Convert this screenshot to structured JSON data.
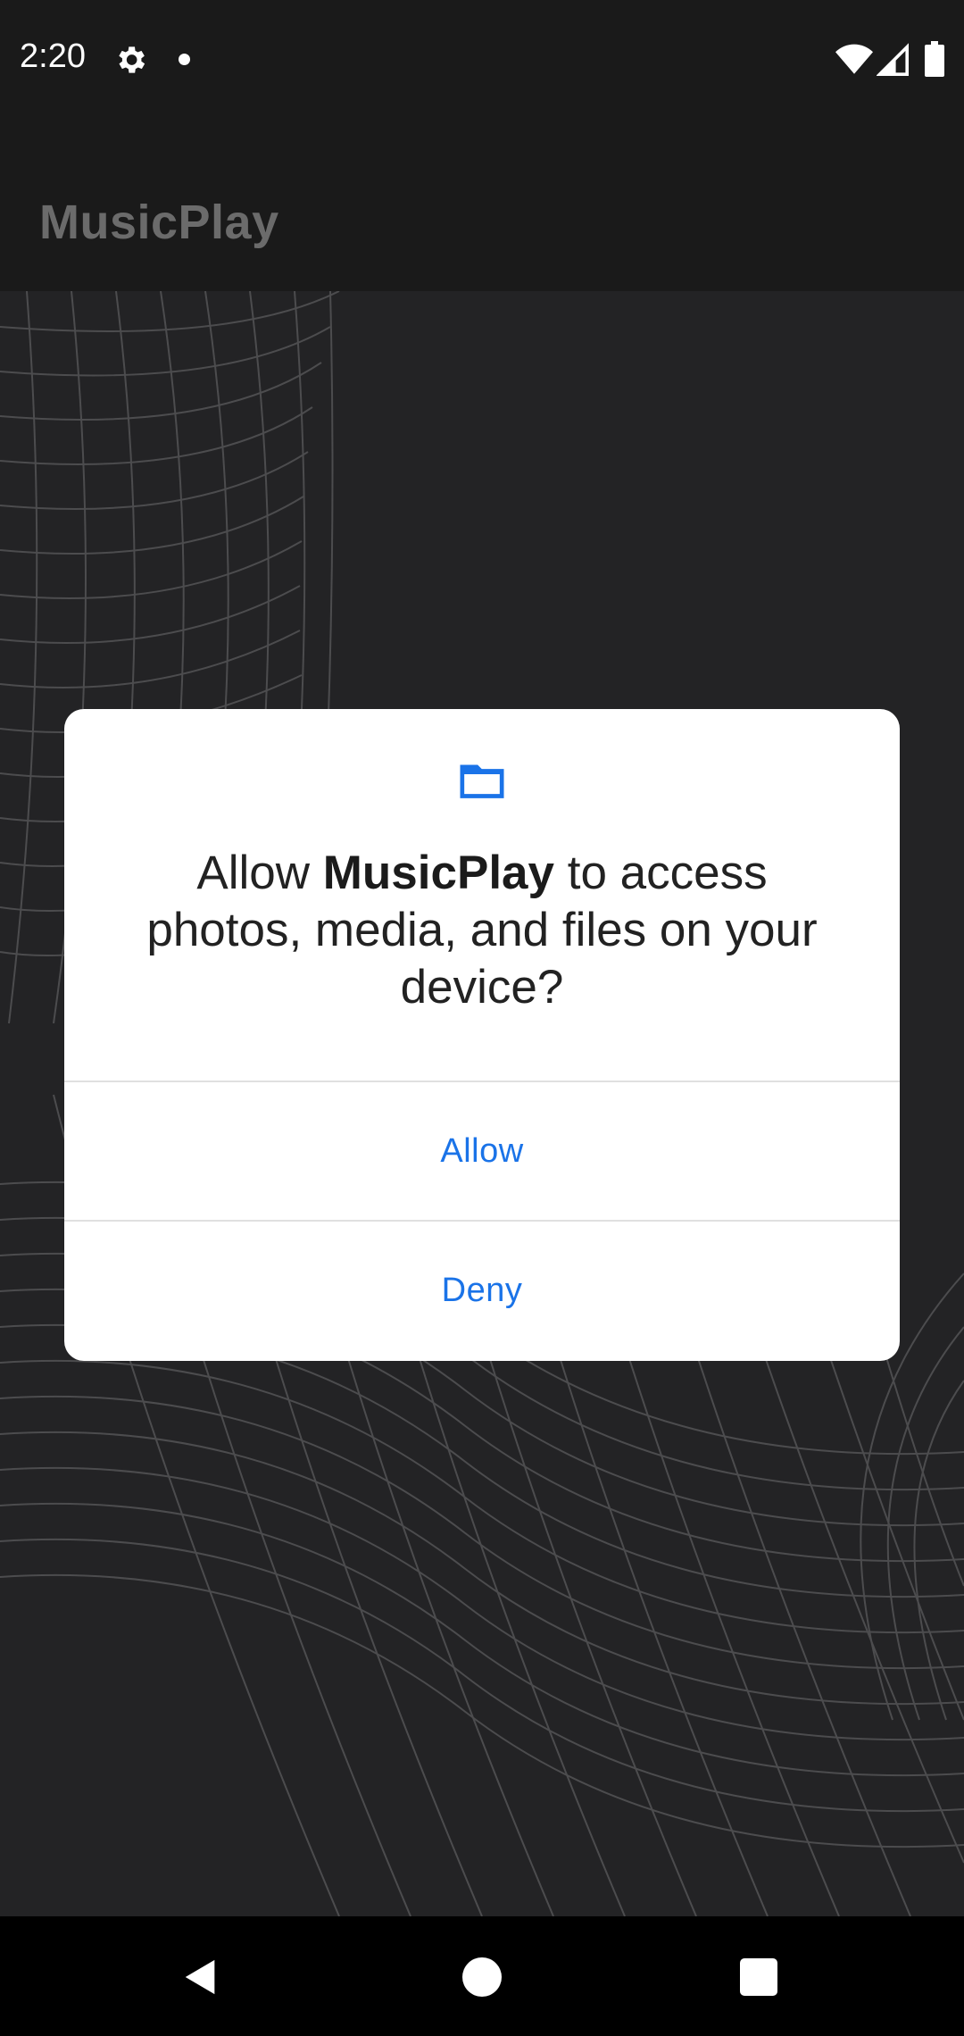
{
  "status_bar": {
    "time": "2:20",
    "icons": [
      "gear-icon",
      "notification-dot-icon",
      "wifi-icon",
      "signal-icon",
      "battery-icon"
    ]
  },
  "app_bar": {
    "title": "MusicPlay"
  },
  "dialog": {
    "icon": "folder-icon",
    "message_prefix": "Allow ",
    "message_app": "MusicPlay",
    "message_suffix": " to access photos, media, and files on your device?",
    "allow_label": "Allow",
    "deny_label": "Deny"
  },
  "nav_bar": {
    "icons": [
      "back-icon",
      "home-icon",
      "recents-icon"
    ]
  },
  "colors": {
    "accent": "#1a73e8",
    "status_bar_bg": "#1a1a1a",
    "app_title": "#6b6b6b",
    "background": "#232325",
    "dialog_bg": "#ffffff"
  }
}
